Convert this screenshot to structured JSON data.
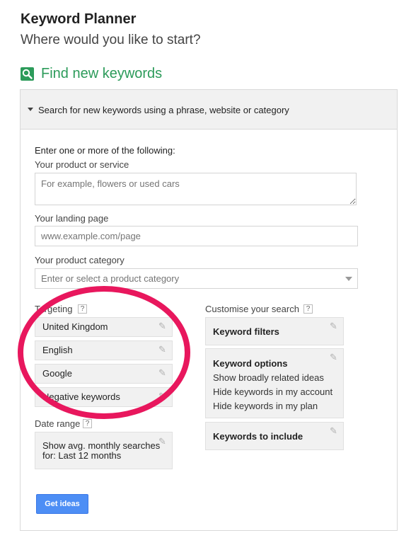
{
  "header": {
    "title": "Keyword Planner",
    "subtitle": "Where would you like to start?"
  },
  "section": {
    "icon": "search-icon",
    "title": "Find new keywords",
    "panel_header": "Search for new keywords using a phrase, website or category"
  },
  "form": {
    "instructions": "Enter one or more of the following:",
    "product_label": "Your product or service",
    "product_placeholder": "For example, flowers or used cars",
    "landing_label": "Your landing page",
    "landing_placeholder": "www.example.com/page",
    "category_label": "Your product category",
    "category_placeholder": "Enter or select a product category"
  },
  "targeting": {
    "label": "Targeting",
    "help": "?",
    "items": [
      "United Kingdom",
      "English",
      "Google",
      "Negative keywords"
    ]
  },
  "date_range": {
    "label": "Date range",
    "help": "?",
    "value_line1": "Show avg. monthly searches",
    "value_line2": "for: Last 12 months"
  },
  "customise": {
    "label": "Customise your search",
    "help": "?",
    "filters_title": "Keyword filters",
    "options_title": "Keyword options",
    "options_lines": [
      "Show broadly related ideas",
      "Hide keywords in my account",
      "Hide keywords in my plan"
    ],
    "include_title": "Keywords to include"
  },
  "actions": {
    "get_ideas": "Get ideas"
  },
  "colors": {
    "accent_green": "#2c9b5a",
    "button_blue": "#4d8ef5",
    "annotation_pink": "#e8175d"
  }
}
